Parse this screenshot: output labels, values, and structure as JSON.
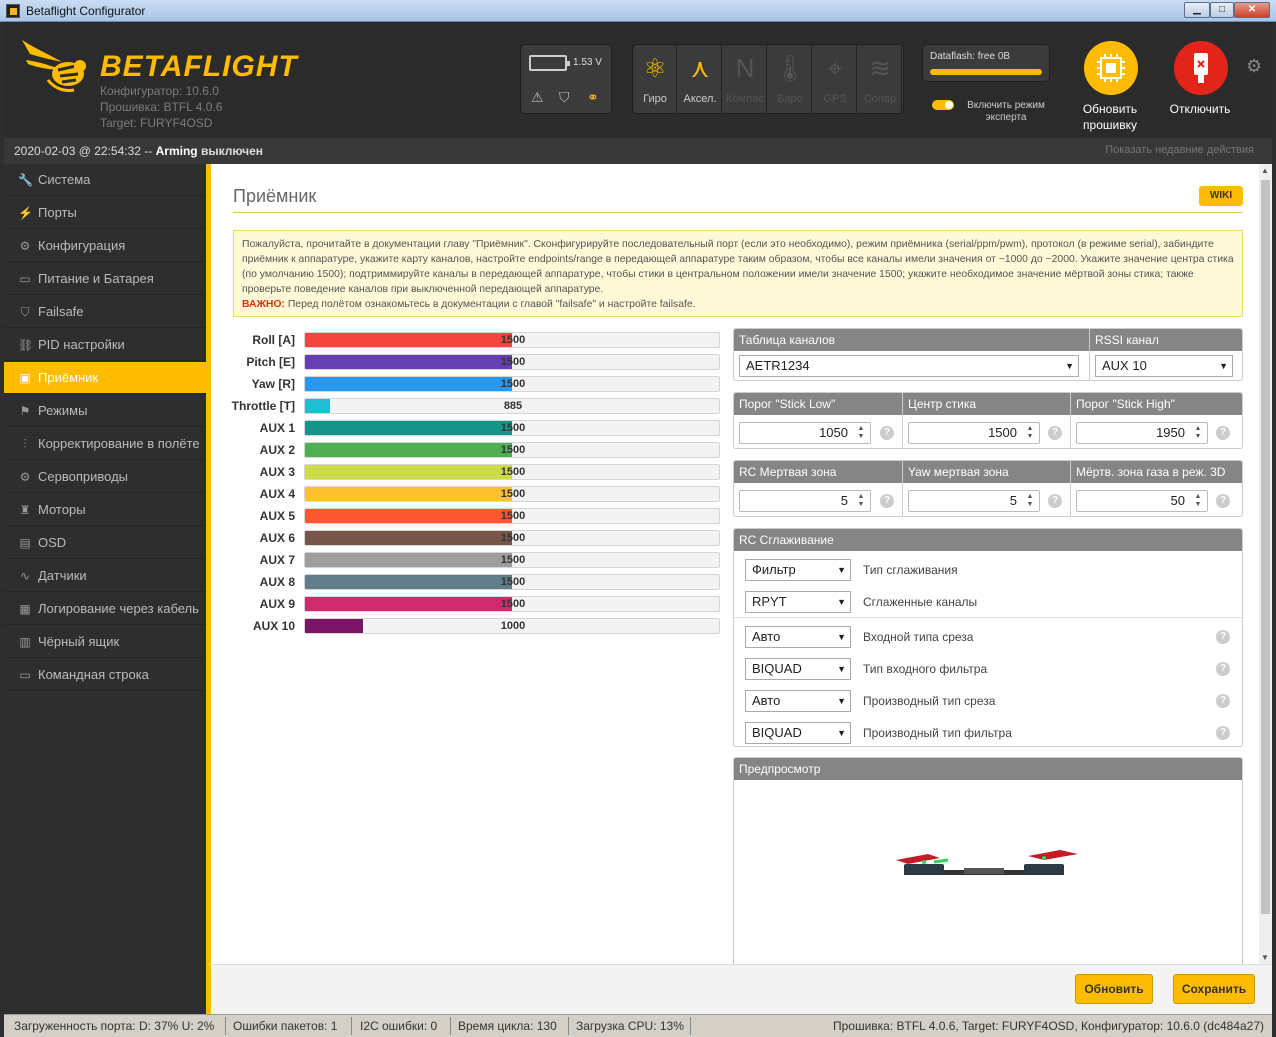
{
  "window": {
    "title": "Betaflight Configurator",
    "min": "▁",
    "max": "□",
    "close": "✕"
  },
  "header": {
    "brand": "BETAFLIGHT",
    "configurator_version": "Конфигуратор: 10.6.0",
    "firmware_version": "Прошивка: BTFL 4.0.6",
    "target": "Target: FURYF4OSD",
    "battery_voltage": "1.53 V",
    "sensors": [
      {
        "label": "Гиро",
        "glyph": "⚛",
        "active": true
      },
      {
        "label": "Аксел.",
        "glyph": "⋏",
        "active": true
      },
      {
        "label": "Компас",
        "glyph": "N",
        "active": false
      },
      {
        "label": "Баро",
        "glyph": "🌡",
        "active": false
      },
      {
        "label": "GPS",
        "glyph": "⌖",
        "active": false
      },
      {
        "label": "Сонар",
        "glyph": "≋",
        "active": false
      }
    ],
    "dataflash": "Dataflash: free 0B",
    "expert_mode": "Включить режим эксперта",
    "expert_mode_on": true,
    "flash_button": "Обновить прошивку",
    "disconnect_button": "Отключить"
  },
  "status": {
    "datetime": "2020-02-03 @ 22:54:32 -- ",
    "arming": "Arming",
    "arming_state": " выключен",
    "recent": "Показать недавние действия"
  },
  "sidebar": {
    "items": [
      {
        "label": "Система",
        "icon": "wrench-icon",
        "glyph": "🔧",
        "active": false
      },
      {
        "label": "Порты",
        "icon": "plug-icon",
        "glyph": "⚡",
        "active": false
      },
      {
        "label": "Конфигурация",
        "icon": "gear-icon",
        "glyph": "⚙",
        "active": false
      },
      {
        "label": "Питание и Батарея",
        "icon": "battery-icon",
        "glyph": "▭",
        "active": false
      },
      {
        "label": "Failsafe",
        "icon": "parachute-icon",
        "glyph": "⛉",
        "active": false
      },
      {
        "label": "PID настройки",
        "icon": "pid-icon",
        "glyph": "⛓",
        "active": false
      },
      {
        "label": "Приёмник",
        "icon": "receiver-icon",
        "glyph": "▣",
        "active": true
      },
      {
        "label": "Режимы",
        "icon": "modes-icon",
        "glyph": "⚑",
        "active": false
      },
      {
        "label": "Корректирование в полёте",
        "icon": "sliders-icon",
        "glyph": "⫶",
        "active": false
      },
      {
        "label": "Сервоприводы",
        "icon": "servo-icon",
        "glyph": "⚙",
        "active": false
      },
      {
        "label": "Моторы",
        "icon": "motor-icon",
        "glyph": "♜",
        "active": false
      },
      {
        "label": "OSD",
        "icon": "osd-icon",
        "glyph": "▤",
        "active": false
      },
      {
        "label": "Датчики",
        "icon": "sensors-icon",
        "glyph": "∿",
        "active": false
      },
      {
        "label": "Логирование через кабель",
        "icon": "logging-icon",
        "glyph": "▦",
        "active": false
      },
      {
        "label": "Чёрный ящик",
        "icon": "blackbox-icon",
        "glyph": "▥",
        "active": false
      },
      {
        "label": "Командная строка",
        "icon": "cli-icon",
        "glyph": "▭",
        "active": false
      }
    ]
  },
  "page": {
    "title": "Приёмник",
    "wiki": "WIKI",
    "note": "Пожалуйста, прочитайте в документации главу \"Приёмник\". Сконфигурируйте последовательный порт (если это необходимо), режим приёмника (serial/ppm/pwm), протокол (в режиме serial), забиндите приёмник к аппаратуре, укажите карту каналов, настройте endpoints/range в передающей аппаратуре таким образом, чтобы все каналы имели значения от ~1000 до ~2000. Укажите значение центра стика (по умолчанию 1500); подтриммируйте каналы в передающей аппаратуре, чтобы стики в центральном положении имели значение 1500; укажите необходимое значение мёртвой зоны стика; также проверьте поведение каналов при выключенной передающей аппаратуре.",
    "note_important": "ВАЖНО:",
    "note_important_text": " Перед полётом ознакомьтесь в документации с главой \"failsafe\" и настройте failsafe."
  },
  "channels": [
    {
      "label": "Roll [A]",
      "value": "1500",
      "fraction": 0.5,
      "color": "#f1453d"
    },
    {
      "label": "Pitch [E]",
      "value": "1500",
      "fraction": 0.5,
      "color": "#673fb4"
    },
    {
      "label": "Yaw [R]",
      "value": "1500",
      "fraction": 0.5,
      "color": "#2b98f0"
    },
    {
      "label": "Throttle [T]",
      "value": "885",
      "fraction": 0.06,
      "color": "#1fbcd2"
    },
    {
      "label": "AUX 1",
      "value": "1500",
      "fraction": 0.5,
      "color": "#159588"
    },
    {
      "label": "AUX 2",
      "value": "1500",
      "fraction": 0.5,
      "color": "#50ae55"
    },
    {
      "label": "AUX 3",
      "value": "1500",
      "fraction": 0.5,
      "color": "#cdda49"
    },
    {
      "label": "AUX 4",
      "value": "1500",
      "fraction": 0.5,
      "color": "#fdc02f"
    },
    {
      "label": "AUX 5",
      "value": "1500",
      "fraction": 0.5,
      "color": "#fc5830"
    },
    {
      "label": "AUX 6",
      "value": "1500",
      "fraction": 0.5,
      "color": "#785549"
    },
    {
      "label": "AUX 7",
      "value": "1500",
      "fraction": 0.5,
      "color": "#9e9e9e"
    },
    {
      "label": "AUX 8",
      "value": "1500",
      "fraction": 0.5,
      "color": "#617d8a"
    },
    {
      "label": "AUX 9",
      "value": "1500",
      "fraction": 0.5,
      "color": "#cf2a6d"
    },
    {
      "label": "AUX 10",
      "value": "1000",
      "fraction": 0.14,
      "color": "#7a1464"
    }
  ],
  "settings": {
    "channel_map_label": "Таблица каналов",
    "channel_map_value": "AETR1234",
    "rssi_label": "RSSI канал",
    "rssi_value": "AUX 10",
    "stick_low_label": "Порог \"Stick Low\"",
    "stick_low_value": "1050",
    "stick_center_label": "Центр стика",
    "stick_center_value": "1500",
    "stick_high_label": "Порог \"Stick High\"",
    "stick_high_value": "1950",
    "rc_deadband_label": "RC Мертвая зона",
    "rc_deadband_value": "5",
    "yaw_deadband_label": "Yaw мертвая зона",
    "yaw_deadband_value": "5",
    "throttle3d_label": "Мёртв. зона газа в реж. 3D",
    "throttle3d_value": "50",
    "smoothing_title": "RC Сглаживание",
    "smoothing_rows": [
      {
        "value": "Фильтр",
        "label": "Тип сглаживания",
        "help": false
      },
      {
        "value": "RPYT",
        "label": "Сглаженные каналы",
        "help": false
      },
      {
        "value": "Авто",
        "label": "Входной типа среза",
        "help": true
      },
      {
        "value": "BIQUAD",
        "label": "Тип входного фильтра",
        "help": true
      },
      {
        "value": "Авто",
        "label": "Производный тип среза",
        "help": true
      },
      {
        "value": "BIQUAD",
        "label": "Производный тип фильтра",
        "help": true
      }
    ],
    "preview_title": "Предпросмотр"
  },
  "actions": {
    "refresh": "Обновить",
    "save": "Сохранить"
  },
  "footer": {
    "port_usage": "Загруженность порта: D: 37% U: 2%",
    "packet_errors": "Ошибки пакетов: 1",
    "i2c_errors": "I2C ошибки: 0",
    "cycle_time": "Время цикла: 130",
    "cpu_load": "Загрузка CPU: 13%",
    "firmware_info": "Прошивка: BTFL 4.0.6, Target: FURYF4OSD, Конфигуратор: 10.6.0 (dc484a27)"
  },
  "colors": {
    "accent": "#ffbb00",
    "disconnect": "#e2241b",
    "important": "#e2300e"
  }
}
